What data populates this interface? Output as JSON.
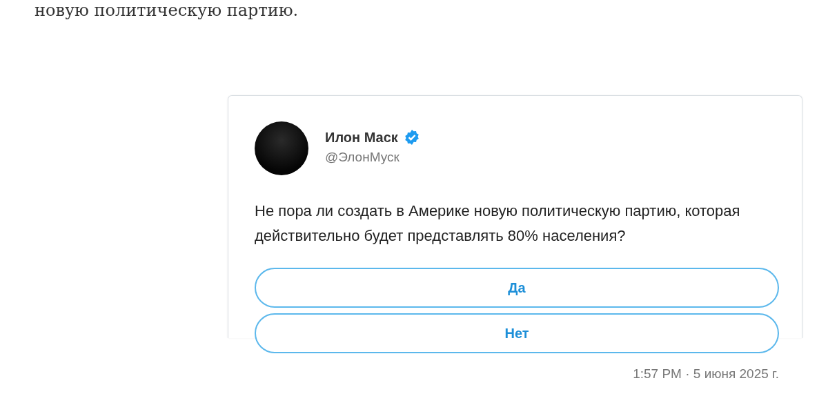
{
  "article_text": "новую политическую партию.",
  "tweet": {
    "author": "Илон Маск",
    "verified": true,
    "handle": "@ЭлонМуск",
    "text": "Не пора ли создать в Америке новую политическую партию, которая действительно будет представлять 80% населения?",
    "poll_options": [
      {
        "label": "Да"
      },
      {
        "label": "Нет"
      }
    ],
    "timestamp": "1:57 PM · 5 июня 2025 г."
  }
}
